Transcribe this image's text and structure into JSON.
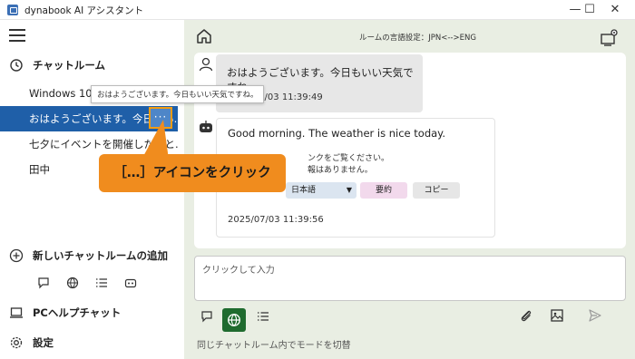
{
  "window": {
    "title": "dynabook AI アシスタント",
    "minimize": "—",
    "maximize": "☐",
    "close": "✕"
  },
  "sidebar": {
    "chat_rooms_label": "チャットルーム",
    "rooms": [
      {
        "label": "Windows 10の",
        "active": false
      },
      {
        "label": "おはようございます。今日もい...",
        "active": true
      },
      {
        "label": "七夕にイベントを開催したいと...",
        "active": false
      },
      {
        "label": "田中",
        "active": false
      }
    ],
    "more_button": "···",
    "tooltip": "おはようございます。今日もいい天気ですね。",
    "add_room_label": "新しいチャットルームの追加",
    "pc_help_label": "PCヘルプチャット",
    "settings_label": "設定",
    "mode_icons": [
      "chat-icon",
      "globe-icon",
      "list-icon",
      "bot-icon"
    ]
  },
  "main": {
    "lang_setting": "ルームの言語設定：JPN<-->ENG",
    "user_message": {
      "text": "おはようございます。今日もいい天気ですね。",
      "time": "2025/07/03 11:39:49"
    },
    "bot_message": {
      "text": "Good morning. The weather is nice today.",
      "line2": "ンクをご覧ください。",
      "line3": "報はありません。",
      "language_select": "日本語",
      "summary_button": "要約",
      "copy_button": "コピー",
      "time": "2025/07/03 11:39:56"
    },
    "input_placeholder": "クリックして入力",
    "footer": "同じチャットルーム内でモードを切替"
  },
  "callout": "［…］アイコンをクリック",
  "colors": {
    "active_room": "#1f5fa8",
    "main_bg": "#e9eee3",
    "callout": "#f08c1e",
    "active_mode": "#1f6b2f",
    "summary_btn": "#f2d9ec",
    "copy_btn": "#e6e6e6",
    "lang_select": "#dbe5f0"
  }
}
